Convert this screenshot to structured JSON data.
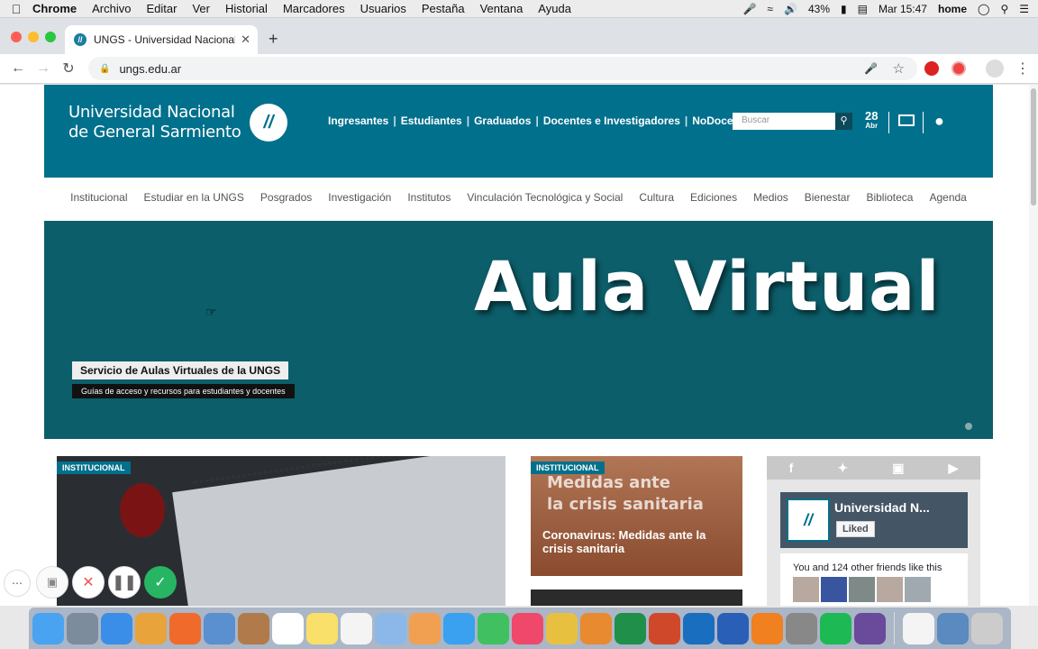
{
  "menubar": {
    "items": [
      "Chrome",
      "Archivo",
      "Editar",
      "Ver",
      "Historial",
      "Marcadores",
      "Usuarios",
      "Pestaña",
      "Ventana",
      "Ayuda"
    ],
    "battery": "43%",
    "clock": "Mar 15:47",
    "user": "home"
  },
  "browser": {
    "tab_title": "UNGS - Universidad Nacional de General Sarmiento",
    "url": "ungs.edu.ar"
  },
  "site": {
    "logo_line1": "Universidad Nacional",
    "logo_line2": "de General Sarmiento",
    "header_nav": [
      "Ingresantes",
      "Estudiantes",
      "Graduados",
      "Docentes e Investigadores",
      "NoDocentes"
    ],
    "search_placeholder": "Buscar",
    "date_day": "28",
    "date_month": "Abr",
    "main_nav": [
      "Institucional",
      "Estudiar en la UNGS",
      "Posgrados",
      "Investigación",
      "Institutos",
      "Vinculación Tecnológica y Social",
      "Cultura",
      "Ediciones",
      "Medios",
      "Bienestar",
      "Biblioteca",
      "Agenda"
    ],
    "hero": {
      "title": "Aula Virtual",
      "caption": "Servicio de Aulas Virtuales de la UNGS",
      "subcaption": "Guías de acceso y recursos para estudiantes y docentes"
    },
    "card1_tag": "INSTITUCIONAL",
    "card2": {
      "tag": "INSTITUCIONAL",
      "image_text_1": "Medidas ante",
      "image_text_2": "la crisis sanitaria",
      "title": "Coronavirus: Medidas ante la crisis sanitaria"
    },
    "social": {
      "fb_name": "Universidad N...",
      "fb_liked": "Liked",
      "friends_text": "You and 124 other friends like this"
    }
  },
  "dock_apps": [
    "Finder",
    "Launchpad",
    "Safari",
    "Chrome",
    "Firefox",
    "Mail",
    "Contacts",
    "Calendar",
    "Notes",
    "Reminders",
    "Preview",
    "Photos",
    "Messages",
    "FaceTime",
    "Music",
    "iMovie",
    "GarageBand",
    "Excel",
    "PowerPoint",
    "Outlook",
    "Word",
    "VLC",
    "System Preferences",
    "Spotify",
    "Launcher",
    "Document",
    "Downloads",
    "Trash"
  ]
}
